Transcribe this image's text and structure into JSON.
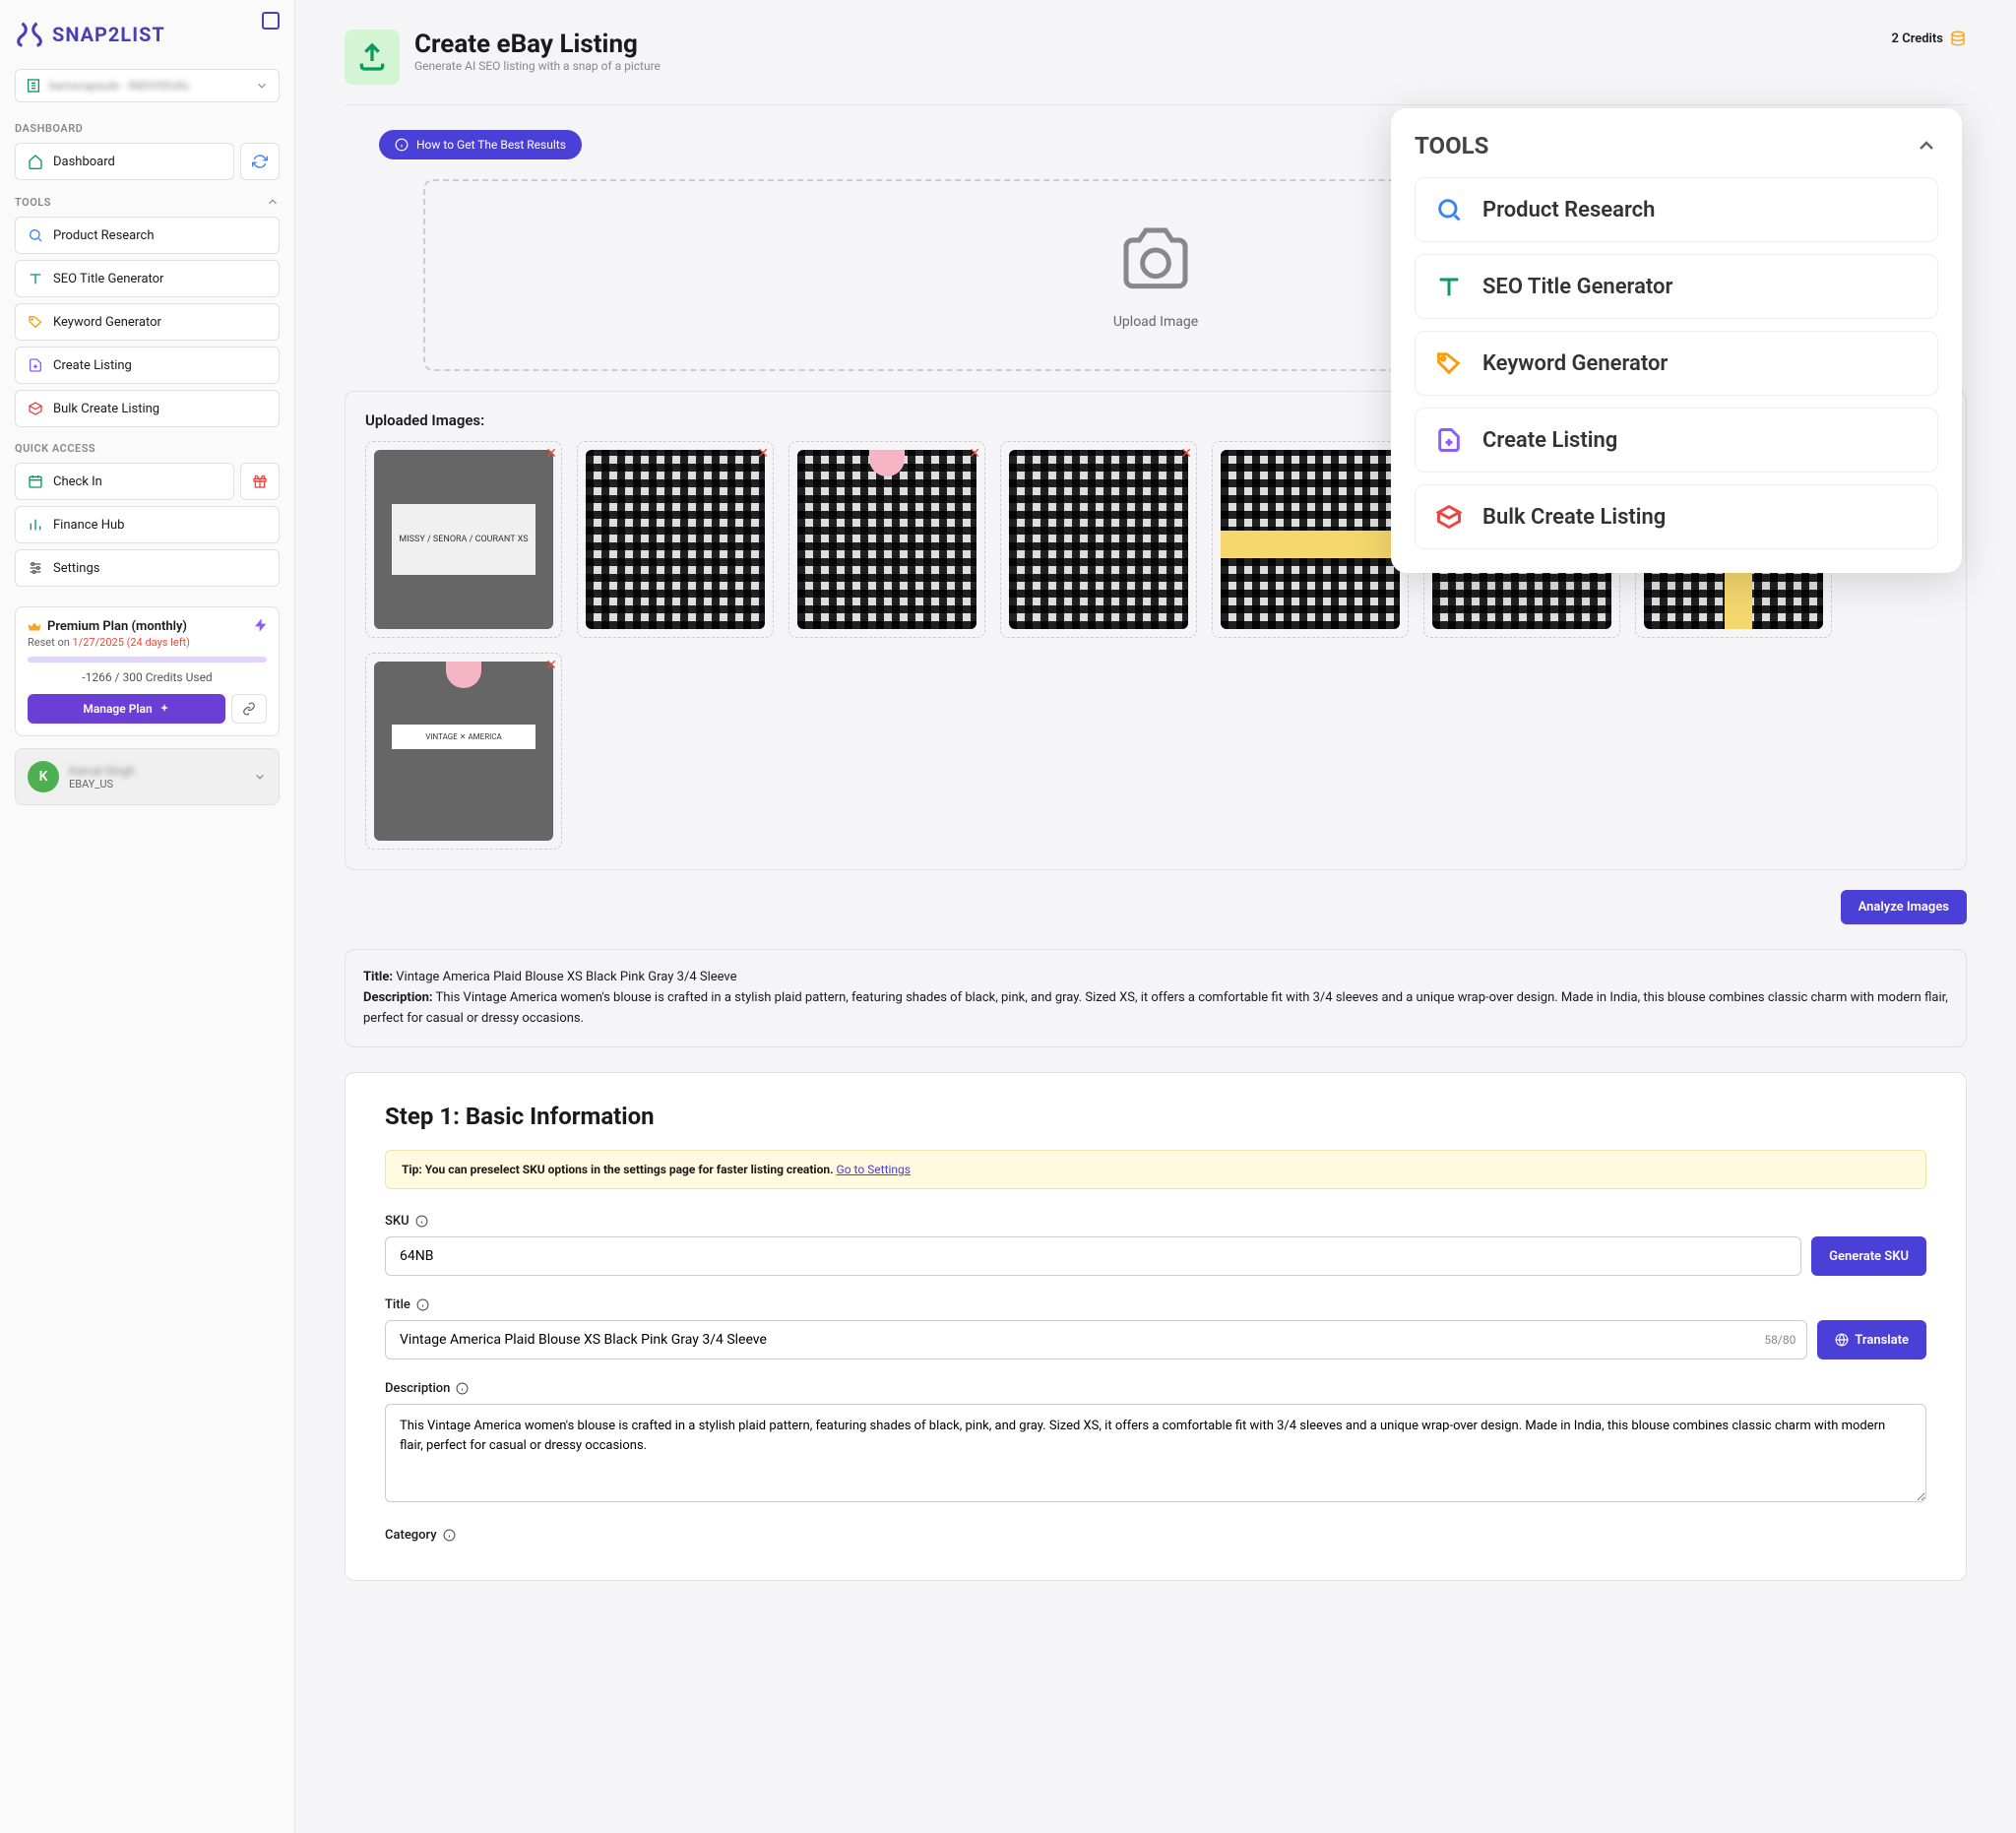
{
  "brand": "SNAP2LIST",
  "account_selector": "kamscapsule - INDIVIDUAL",
  "sidebar": {
    "dashboard_label": "DASHBOARD",
    "dashboard_item": "Dashboard",
    "tools_label": "TOOLS",
    "tools": [
      "Product Research",
      "SEO Title Generator",
      "Keyword Generator",
      "Create Listing",
      "Bulk Create Listing"
    ],
    "quick_label": "QUICK ACCESS",
    "quick": [
      "Check In",
      "Finance Hub",
      "Settings"
    ]
  },
  "plan": {
    "title": "Premium Plan (monthly)",
    "reset_prefix": "Reset on ",
    "reset_date": "1/27/2025 (24 days left)",
    "credits": "-1266 / 300 Credits Used",
    "manage": "Manage Plan"
  },
  "user": {
    "initial": "K",
    "name": "Kamal Singh",
    "sub": "EBAY_US"
  },
  "header": {
    "title": "Create eBay Listing",
    "subtitle": "Generate AI SEO listing with a snap of a picture",
    "credits": "2 Credits"
  },
  "tip_button": "How to Get The Best Results",
  "upload": {
    "cta": "Upload Image",
    "section_label": "Uploaded Images:"
  },
  "thumbs_label1": "MISSY / SENORA / COURANT\nXS",
  "thumbs_label2": "VINTAGE ✕ AMERICA",
  "analyze_btn": "Analyze Images",
  "result": {
    "title_label": "Title:",
    "title": "Vintage America Plaid Blouse XS Black Pink Gray 3/4 Sleeve",
    "desc_label": "Description:",
    "desc": "This Vintage America women's blouse is crafted in a stylish plaid pattern, featuring shades of black, pink, and gray. Sized XS, it offers a comfortable fit with 3/4 sleeves and a unique wrap-over design. Made in India, this blouse combines classic charm with modern flair, perfect for casual or dressy occasions."
  },
  "step": {
    "title": "Step 1: Basic Information",
    "tip_prefix": "Tip: You can preselect SKU options in the settings page for faster listing creation. ",
    "tip_link": "Go to Settings",
    "sku_label": "SKU",
    "sku_value": "64NB",
    "sku_btn": "Generate SKU",
    "title_label": "Title",
    "title_value": "Vintage America Plaid Blouse XS Black Pink Gray 3/4 Sleeve",
    "title_counter": "58/80",
    "translate_btn": "Translate",
    "desc_label": "Description",
    "desc_value": "This Vintage America women's blouse is crafted in a stylish plaid pattern, featuring shades of black, pink, and gray. Sized XS, it offers a comfortable fit with 3/4 sleeves and a unique wrap-over design. Made in India, this blouse combines classic charm with modern flair, perfect for casual or dressy occasions.",
    "category_label": "Category"
  },
  "popup": {
    "title": "TOOLS",
    "items": [
      "Product Research",
      "SEO Title Generator",
      "Keyword Generator",
      "Create Listing",
      "Bulk Create Listing"
    ]
  }
}
